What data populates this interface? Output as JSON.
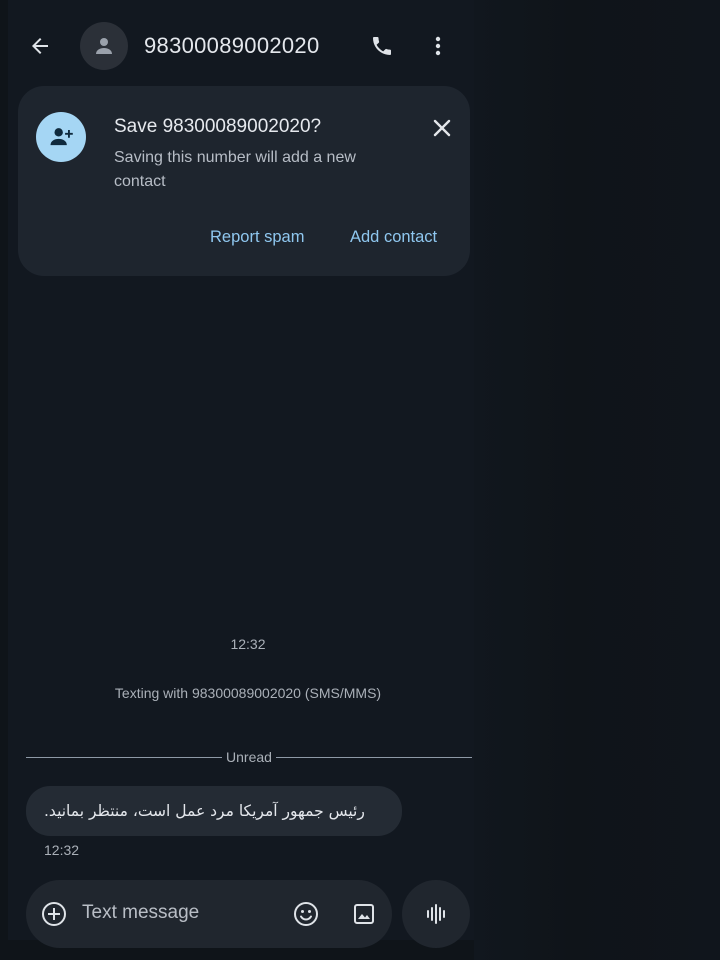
{
  "header": {
    "back_icon": "arrow-left-icon",
    "avatar_icon": "person-icon",
    "title": "98300089002020",
    "call_icon": "phone-icon",
    "more_icon": "more-vertical-icon"
  },
  "save_card": {
    "icon": "person-add-icon",
    "title": "Save 98300089002020?",
    "description": "Saving this number will add a new contact",
    "close_icon": "close-icon",
    "report_spam_label": "Report spam",
    "add_contact_label": "Add contact",
    "accent_color": "#8fc7ef"
  },
  "conversation": {
    "top_timestamp": "12:32",
    "texting_with": "Texting with 98300089002020 (SMS/MMS)",
    "unread_label": "Unread",
    "messages": [
      {
        "text": "رئیس جمهور آمریکا مرد عمل است، منتظر بمانید.",
        "time": "12:32",
        "direction": "incoming"
      }
    ]
  },
  "compose": {
    "add_icon": "plus-circle-icon",
    "placeholder": "Text message",
    "emoji_icon": "emoji-icon",
    "gallery_icon": "image-icon",
    "voice_icon": "voice-waveform-icon"
  }
}
